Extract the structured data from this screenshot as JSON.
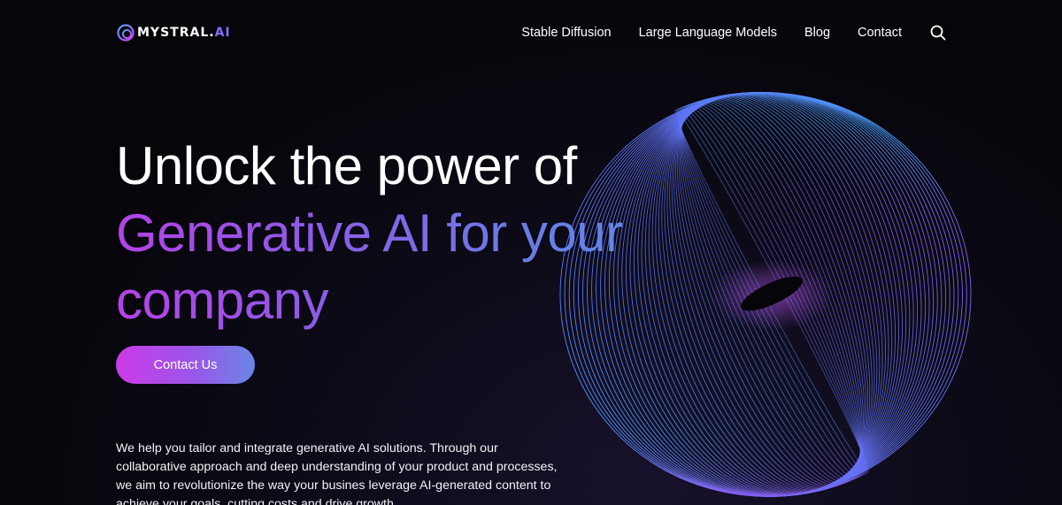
{
  "header": {
    "logo": {
      "text_main": "MYSTRAL.",
      "text_accent": "AI"
    },
    "nav": [
      {
        "label": "Stable Diffusion"
      },
      {
        "label": "Large Language Models"
      },
      {
        "label": "Blog"
      },
      {
        "label": "Contact"
      }
    ],
    "search_icon": "search-icon"
  },
  "hero": {
    "headline_line1": "Unlock the power of",
    "headline_line2": "Generative AI for your",
    "headline_line3": "company",
    "cta_label": "Contact Us",
    "description": "We help you tailor and integrate generative AI solutions. Through our collaborative approach and deep understanding of your product and processes, we aim to revolutionize the way your busines leverage AI-generated content to achieve your goals, cutting costs and drive growth."
  },
  "colors": {
    "background": "#060509",
    "gradient_start": "#b443e8",
    "gradient_end": "#5b8ee6",
    "accent": "#8a6cff"
  }
}
